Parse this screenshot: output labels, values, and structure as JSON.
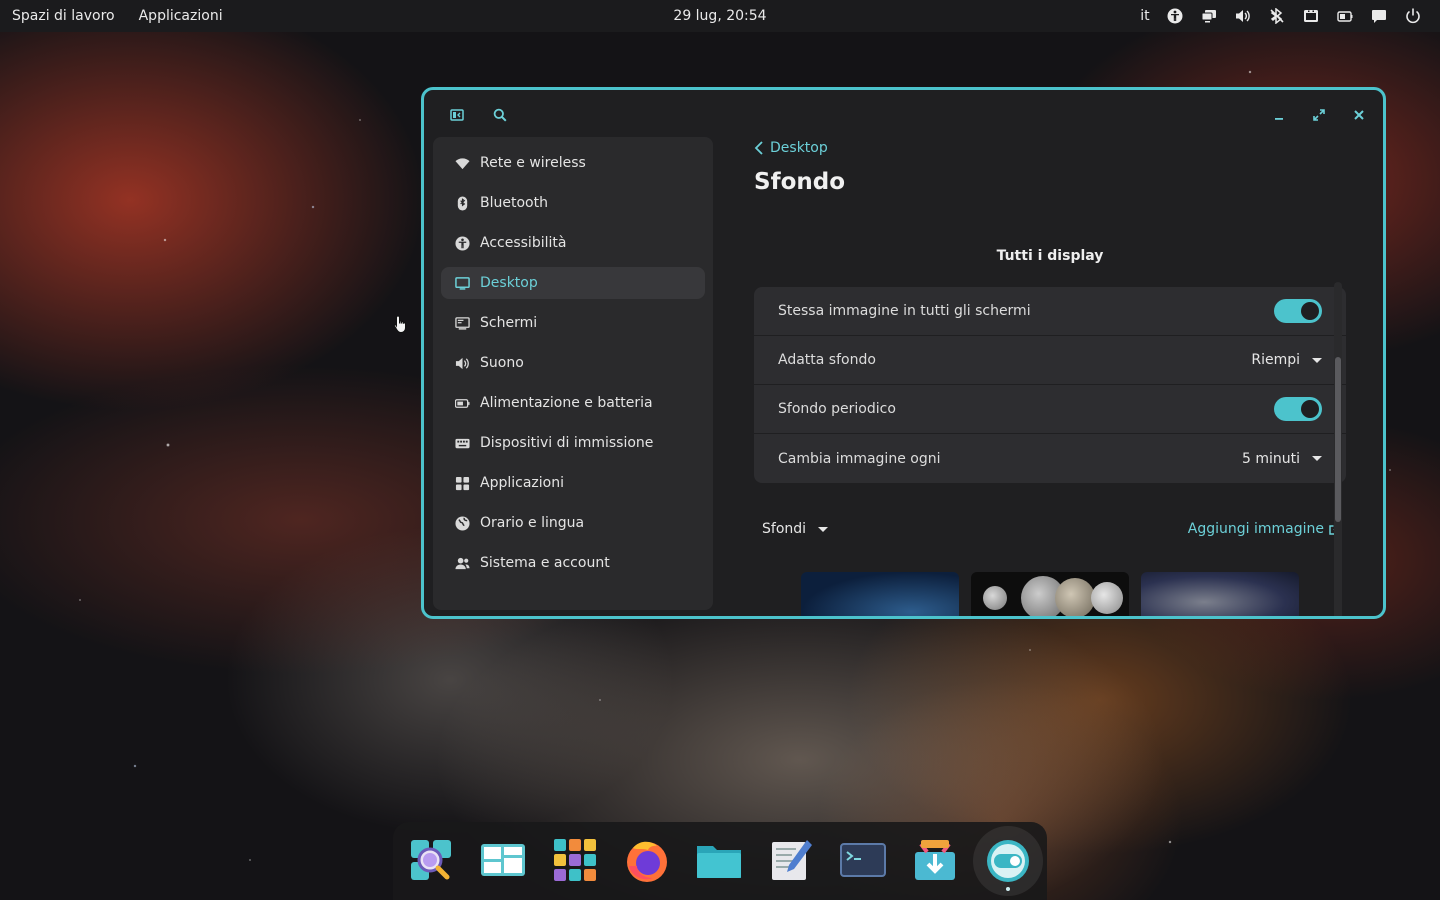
{
  "topbar": {
    "workspaces": "Spazi di lavoro",
    "applications": "Applicazioni",
    "clock": "29 lug, 20:54",
    "lang": "it",
    "tray_icons": [
      "accessibility-icon",
      "displays-icon",
      "volume-icon",
      "bluetooth-off-icon",
      "media-icon",
      "battery-icon",
      "notifications-icon",
      "power-icon"
    ]
  },
  "window": {
    "sidebar": {
      "items": [
        {
          "label": "Rete e wireless",
          "icon": "wifi-icon"
        },
        {
          "label": "Bluetooth",
          "icon": "bluetooth-icon"
        },
        {
          "label": "Accessibilità",
          "icon": "accessibility-icon"
        },
        {
          "label": "Desktop",
          "icon": "desktop-icon",
          "active": true
        },
        {
          "label": "Schermi",
          "icon": "display-icon"
        },
        {
          "label": "Suono",
          "icon": "sound-icon"
        },
        {
          "label": "Alimentazione e batteria",
          "icon": "battery-icon"
        },
        {
          "label": "Dispositivi di immissione",
          "icon": "keyboard-icon"
        },
        {
          "label": "Applicazioni",
          "icon": "apps-grid-icon"
        },
        {
          "label": "Orario e lingua",
          "icon": "globe-icon"
        },
        {
          "label": "Sistema e account",
          "icon": "users-icon"
        }
      ]
    },
    "content": {
      "back_label": "Desktop",
      "title": "Sfondo",
      "section_title": "Tutti i display",
      "rows": [
        {
          "label": "Stessa immagine in tutti gli schermi",
          "toggle": true
        },
        {
          "label": "Adatta sfondo",
          "value": "Riempi"
        },
        {
          "label": "Sfondo periodico",
          "toggle": true
        },
        {
          "label": "Cambia immagine ogni",
          "value": "5 minuti"
        }
      ],
      "wallpaper_source": "Sfondi",
      "add_image": "Aggiungi immagine"
    }
  },
  "dock": {
    "apps": [
      "launcher-search-icon",
      "workspaces-icon",
      "app-grid-icon",
      "firefox-icon",
      "files-icon",
      "text-editor-icon",
      "terminal-icon",
      "store-icon",
      "settings-icon"
    ]
  },
  "colors": {
    "accent": "#4cc3cc",
    "window_bg": "#1f1f21",
    "sidebar_bg": "#2a2a2c"
  }
}
